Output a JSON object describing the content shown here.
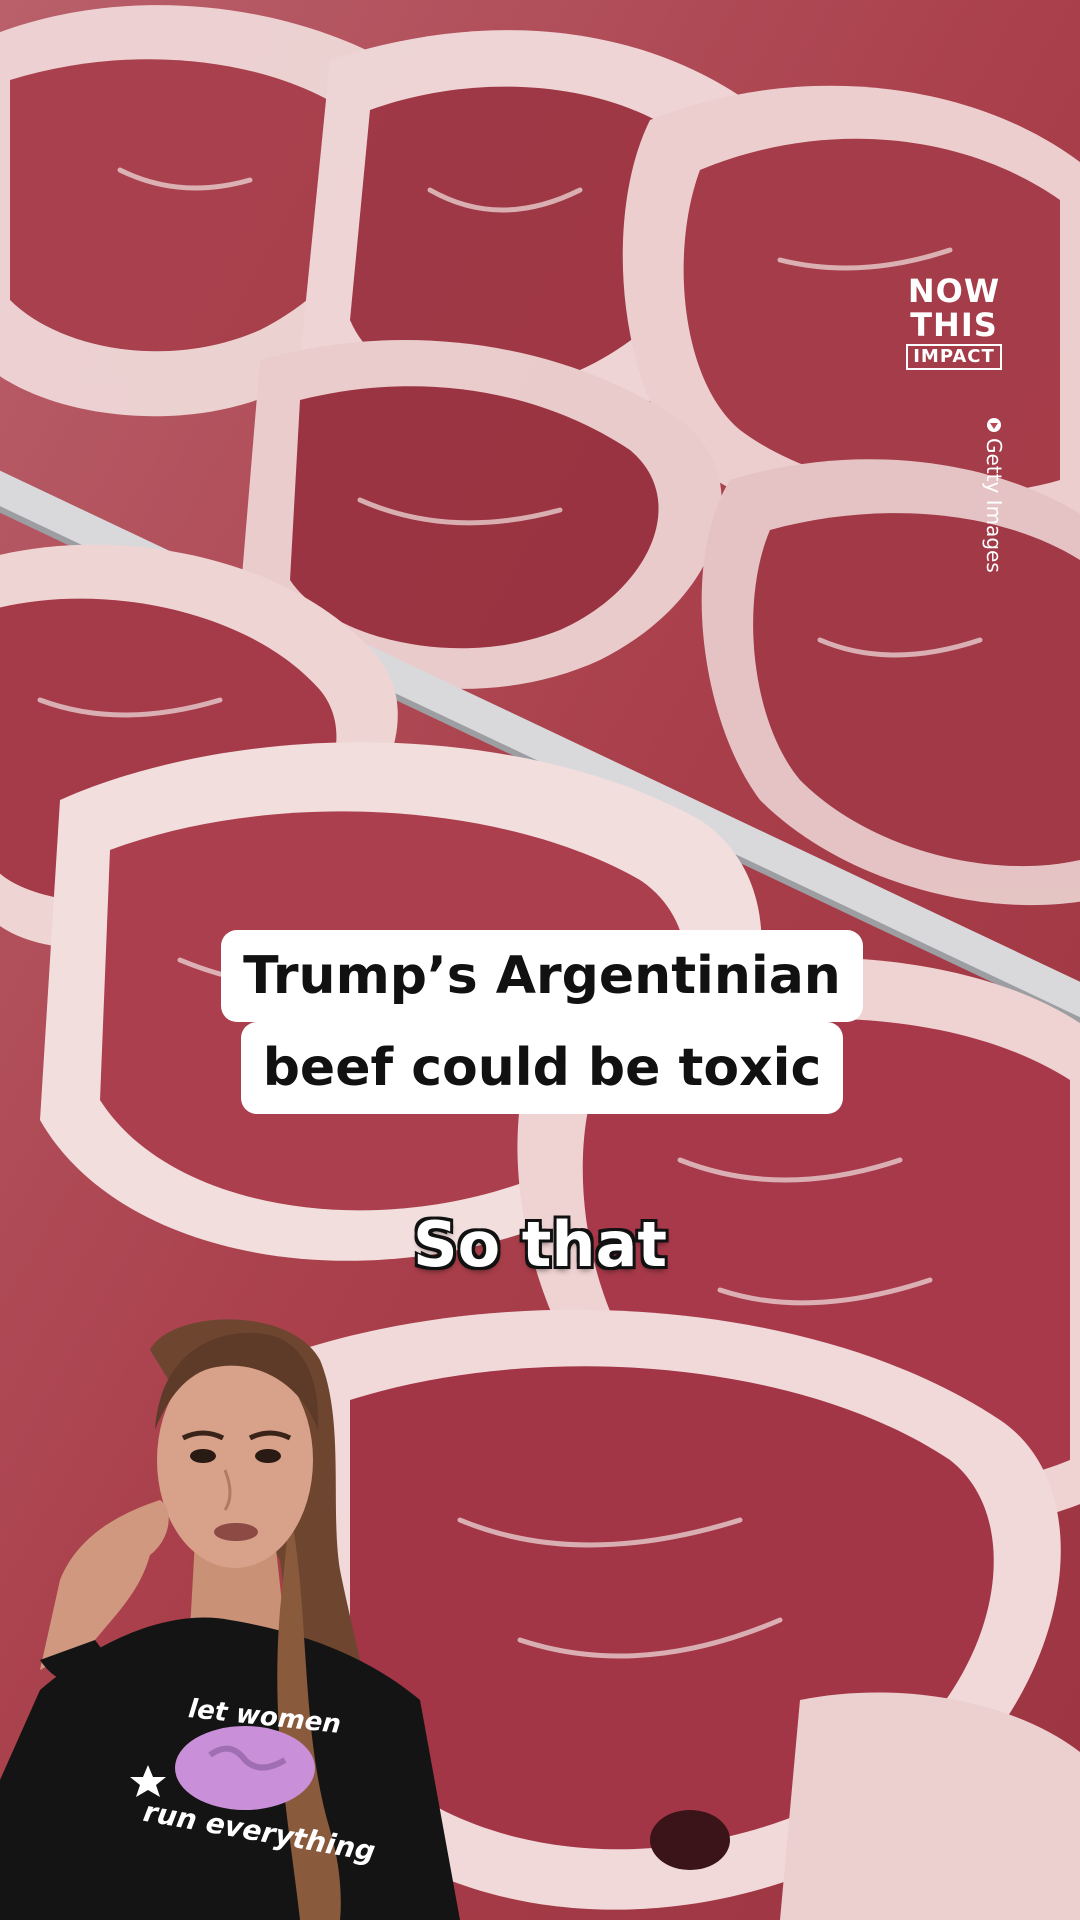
{
  "overlay": {
    "brand_line1": "NOW",
    "brand_line2": "THIS",
    "brand_tag": "IMPACT",
    "credit": "Getty Images",
    "headline_line1": "Trump’s Argentinian",
    "headline_line2": "beef could be toxic",
    "caption": "So that"
  },
  "presenter": {
    "shirt_line1": "let women",
    "shirt_line2": "run everything"
  },
  "icons": {
    "credit": "play-circle-icon",
    "shirt_star": "star-icon",
    "shirt_globe": "globe-icon"
  },
  "colors": {
    "beef": "#b84a55",
    "fat": "#f0d8d8",
    "caption_text": "#ffffff",
    "headline_bg": "#ffffff",
    "shirt": "#141414"
  }
}
